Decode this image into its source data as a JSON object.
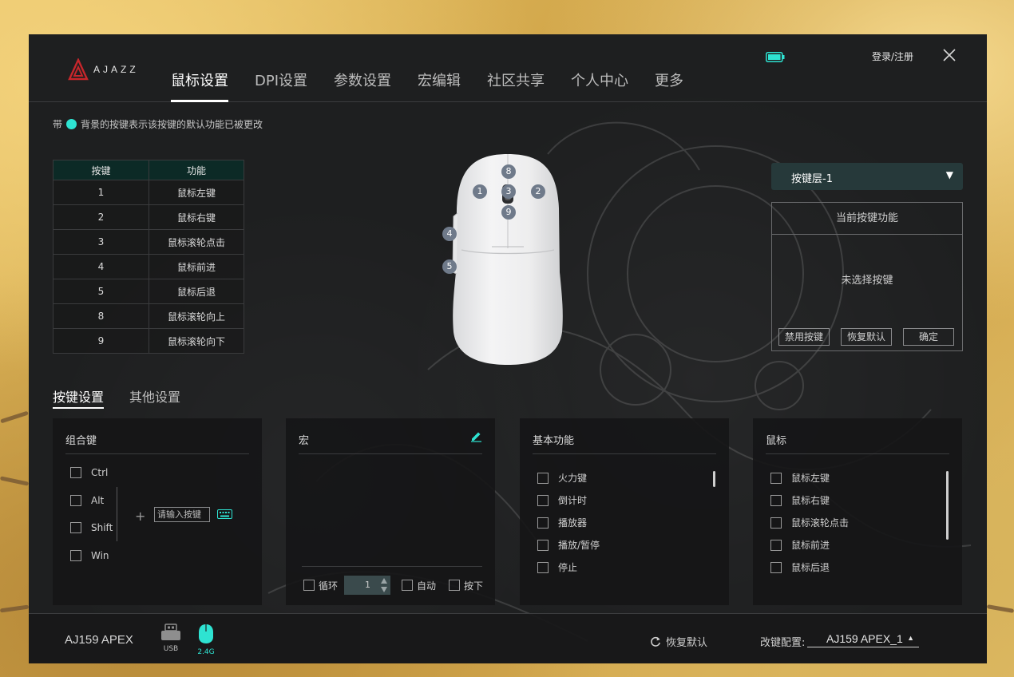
{
  "brand": {
    "logo_text": "AJAZZ"
  },
  "nav": {
    "items": [
      {
        "label": "鼠标设置",
        "active": true
      },
      {
        "label": "DPI设置",
        "active": false
      },
      {
        "label": "参数设置",
        "active": false
      },
      {
        "label": "宏编辑",
        "active": false
      },
      {
        "label": "社区共享",
        "active": false
      },
      {
        "label": "个人中心",
        "active": false
      },
      {
        "label": "更多",
        "active": false
      }
    ]
  },
  "header": {
    "login_label": "登录/注册",
    "battery_icon": "battery-icon",
    "close_icon": "close-icon"
  },
  "hint": {
    "prefix": "带",
    "text": "背景的按键表示该按键的默认功能已被更改",
    "accent": "#2ee3d2"
  },
  "key_table": {
    "headers": [
      "按键",
      "功能"
    ],
    "rows": [
      [
        "1",
        "鼠标左键"
      ],
      [
        "2",
        "鼠标右键"
      ],
      [
        "3",
        "鼠标滚轮点击"
      ],
      [
        "4",
        "鼠标前进"
      ],
      [
        "5",
        "鼠标后退"
      ],
      [
        "8",
        "鼠标滚轮向上"
      ],
      [
        "9",
        "鼠标滚轮向下"
      ]
    ]
  },
  "mouse_buttons": [
    "8",
    "1",
    "3",
    "2",
    "9",
    "4",
    "5"
  ],
  "right_panel": {
    "layer_select": "按键层-1",
    "title": "当前按键功能",
    "empty_text": "未选择按键",
    "buttons": [
      "禁用按键",
      "恢复默认",
      "确定"
    ]
  },
  "subtabs": [
    {
      "label": "按键设置",
      "active": true
    },
    {
      "label": "其他设置",
      "active": false
    }
  ],
  "combo_panel": {
    "title": "组合键",
    "modifiers": [
      "Ctrl",
      "Alt",
      "Shift",
      "Win"
    ],
    "plus": "+",
    "input_placeholder": "请输入按键"
  },
  "macro_panel": {
    "title": "宏",
    "loop_label": "循环",
    "loop_value": "1",
    "auto_label": "自动",
    "press_label": "按下"
  },
  "basic_panel": {
    "title": "基本功能",
    "items": [
      "火力键",
      "倒计时",
      "播放器",
      "播放/暂停",
      "停止"
    ]
  },
  "mouse_panel": {
    "title": "鼠标",
    "items": [
      "鼠标左键",
      "鼠标右键",
      "鼠标滚轮点击",
      "鼠标前进",
      "鼠标后退"
    ]
  },
  "footer": {
    "device_name": "AJ159 APEX",
    "connections": [
      {
        "label": "USB",
        "active": false
      },
      {
        "label": "2.4G",
        "active": true
      }
    ],
    "restore_label": "恢复默认",
    "config_label": "改键配置:",
    "config_value": "AJ159 APEX_1"
  }
}
